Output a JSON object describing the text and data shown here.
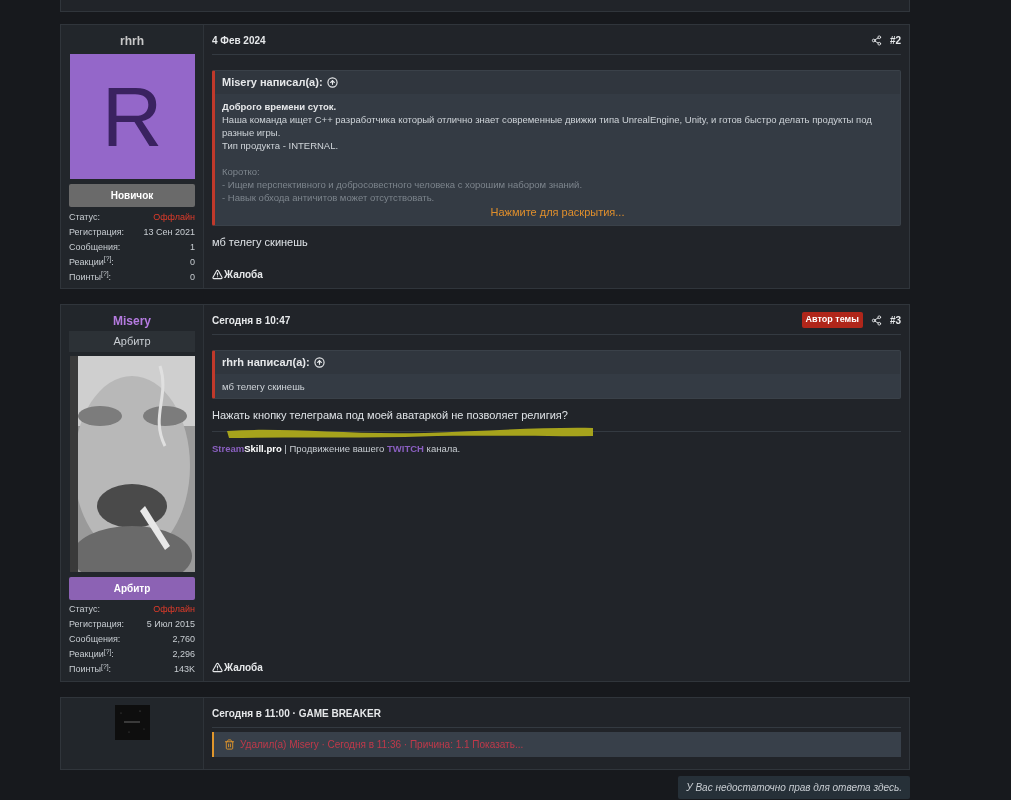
{
  "posts": [
    {
      "kind": "message",
      "author": {
        "name": "rhrh",
        "color": "#c8c8c8",
        "avatar": {
          "kind": "letter",
          "letter": "R"
        },
        "banner": {
          "text": "Новичок",
          "color": "#6a6a6a"
        }
      },
      "stats": [
        {
          "label": "Статус:",
          "value": "Оффлайн",
          "kind": "status"
        },
        {
          "label": "Регистрация:",
          "value": "13 Сен 2021",
          "kind": "plain"
        },
        {
          "label": "Сообщения:",
          "value": "1",
          "kind": "plain"
        },
        {
          "label": "Реакции$^{[?]}$:",
          "value": "0",
          "kind": "plain"
        },
        {
          "label": "Поинты$^{[?]}$:",
          "value": "0",
          "kind": "plain"
        }
      ],
      "date": "4 Фев 2024",
      "number": "#2",
      "quote": {
        "author": "Misery написал(а):",
        "lines": [
          {
            "text": "Доброго времени суток.",
            "bold": true,
            "faded": false
          },
          {
            "text": "Наша команда ищет C++ разработчика который отлично знает современные движки типа UnrealEngine, Unity, и готов быстро делать продукты под разные игры.",
            "bold": false,
            "faded": false
          },
          {
            "text": "Тип продукта - INTERNAL.",
            "bold": false,
            "faded": false
          },
          {
            "text": "Коротко:",
            "bold": false,
            "faded": true
          },
          {
            "text": "- Ищем перспективного и добросовестного человека с хорошим набором знаний.",
            "bold": false,
            "faded": true
          },
          {
            "text": "- Навык обхода античитов может отсутствовать.",
            "bold": false,
            "faded": true
          }
        ],
        "expand": "Нажмите для раскрытия..."
      },
      "body": "мб телегу скинешь",
      "report": "Жалоба"
    },
    {
      "kind": "message",
      "author": {
        "name": "Misery",
        "color": "#b57be0",
        "user_title": "Арбитр",
        "banner": {
          "text": "Арбитр",
          "color": "#8c62b4"
        }
      },
      "stats": [
        {
          "label": "Статус:",
          "value": "Оффлайн",
          "kind": "status"
        },
        {
          "label": "Регистрация:",
          "value": "5 Июл 2015",
          "kind": "plain"
        },
        {
          "label": "Сообщения:",
          "value": "2,760",
          "kind": "plain"
        },
        {
          "label": "Реакции$^{[?]}$:",
          "value": "2,296",
          "kind": "plain"
        },
        {
          "label": "Поинты$^{[?]}$:",
          "value": "143K",
          "kind": "plain"
        }
      ],
      "date": "Сегодня в 10:47",
      "author_badge": "Автор темы",
      "number": "#3",
      "quote": {
        "author": "rhrh написал(а):",
        "lines": [
          {
            "text": "мб телегу скинешь",
            "bold": false,
            "faded": false
          }
        ]
      },
      "body": "Нажать кнопку телеграма под моей аватаркой не позволяет религия?",
      "annotation": {
        "kind": "highlighter"
      },
      "signature": [
        {
          "text": "Stream",
          "kind": "brand"
        },
        {
          "text": "Skill.pro",
          "kind": "strong"
        },
        {
          "text": " | Продвижение вашего ",
          "kind": "plain"
        },
        {
          "text": "TWITCH",
          "kind": "brand"
        },
        {
          "text": " канала.",
          "kind": "plain"
        }
      ],
      "report": "Жалоба"
    },
    {
      "kind": "deleted",
      "date": "Сегодня в 11:00 · GAME BREAKER",
      "notice": "Удалил(а) Misery · Сегодня в 11:36 · Причина: 1.1 Показать..."
    }
  ],
  "notice": "У Вас недостаточно прав для ответа здесь."
}
